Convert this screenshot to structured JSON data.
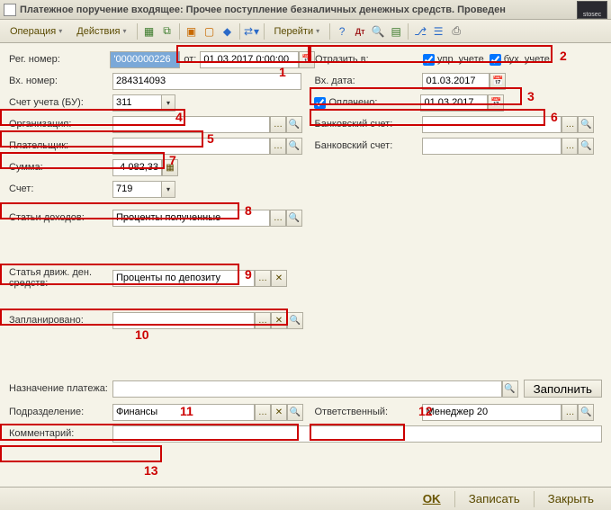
{
  "window": {
    "title": "Платежное поручение входящее: Прочее поступление безналичных денежных средств. Проведен",
    "logo_text": "stosec"
  },
  "toolbar": {
    "operation": "Операция",
    "actions": "Действия",
    "goto": "Перейти"
  },
  "labels": {
    "reg_number": "Рег. номер:",
    "from": "от:",
    "in_number": "Вх. номер:",
    "account_bu": "Счет учета (БУ):",
    "organization": "Организация:",
    "payer": "Плательщик:",
    "sum": "Сумма:",
    "account": "Счет:",
    "income_articles": "Статьи доходов:",
    "movement_article": "Статья движ. ден. средств:",
    "planned": "Запланировано:",
    "payment_purpose": "Назначение платежа:",
    "department": "Подразделение:",
    "comment": "Комментарий:",
    "reflect_in": "Отразить в:",
    "mgmt_acct": "упр. учете",
    "acct_acct": "бух. учете",
    "in_date": "Вх. дата:",
    "paid": "Оплачено:",
    "bank_account": "Банковский счет:",
    "bank_account2": "Банковский счет:",
    "responsible": "Ответственный:"
  },
  "values": {
    "reg_number": "'0000000226",
    "from_date": "01.03.2017 0:00:00",
    "in_number": "284314093",
    "account_bu": "311",
    "organization": "",
    "payer": "",
    "sum": "4 082,33",
    "account": "719",
    "income_articles": "Проценты полученные",
    "movement_article": "Проценты по депозиту",
    "planned": "",
    "payment_purpose": "",
    "department": "Финансы",
    "comment": "",
    "in_date": "01.03.2017",
    "paid_date": "01.03.2017",
    "bank_account": "",
    "bank_account2": "",
    "responsible": "Менеджер 20",
    "mgmt_checked": true,
    "acct_checked": true,
    "paid_checked": true
  },
  "buttons": {
    "fill": "Заполнить",
    "ok": "OK",
    "save": "Записать",
    "close": "Закрыть"
  },
  "annotations": {
    "n1": "1",
    "n2": "2",
    "n3": "3",
    "n4": "4",
    "n5": "5",
    "n6": "6",
    "n7": "7",
    "n8": "8",
    "n9": "9",
    "n10": "10",
    "n11": "11",
    "n12": "12",
    "n13": "13"
  }
}
